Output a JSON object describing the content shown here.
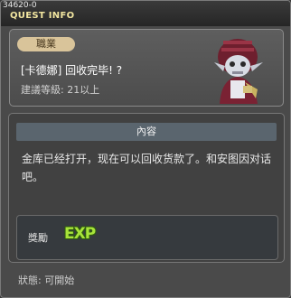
{
  "header": {
    "quest_id": "34620-0",
    "title": "QUEST INFO"
  },
  "quest": {
    "job_badge": "職業",
    "name": "[卡德娜] 回收完毕! ?",
    "level_recommendation": "建議等級: 21以上"
  },
  "content": {
    "header": "內容",
    "text": "金库已经打开，现在可以回收货款了。和安图因对话吧。"
  },
  "reward": {
    "label": "獎勵",
    "exp_icon_text": "EXP"
  },
  "status": {
    "text": "狀態: 可開始"
  },
  "colors": {
    "title": "#f2e6a0",
    "exp": "#a8e43a",
    "content_header_bg": "#5a656e"
  }
}
